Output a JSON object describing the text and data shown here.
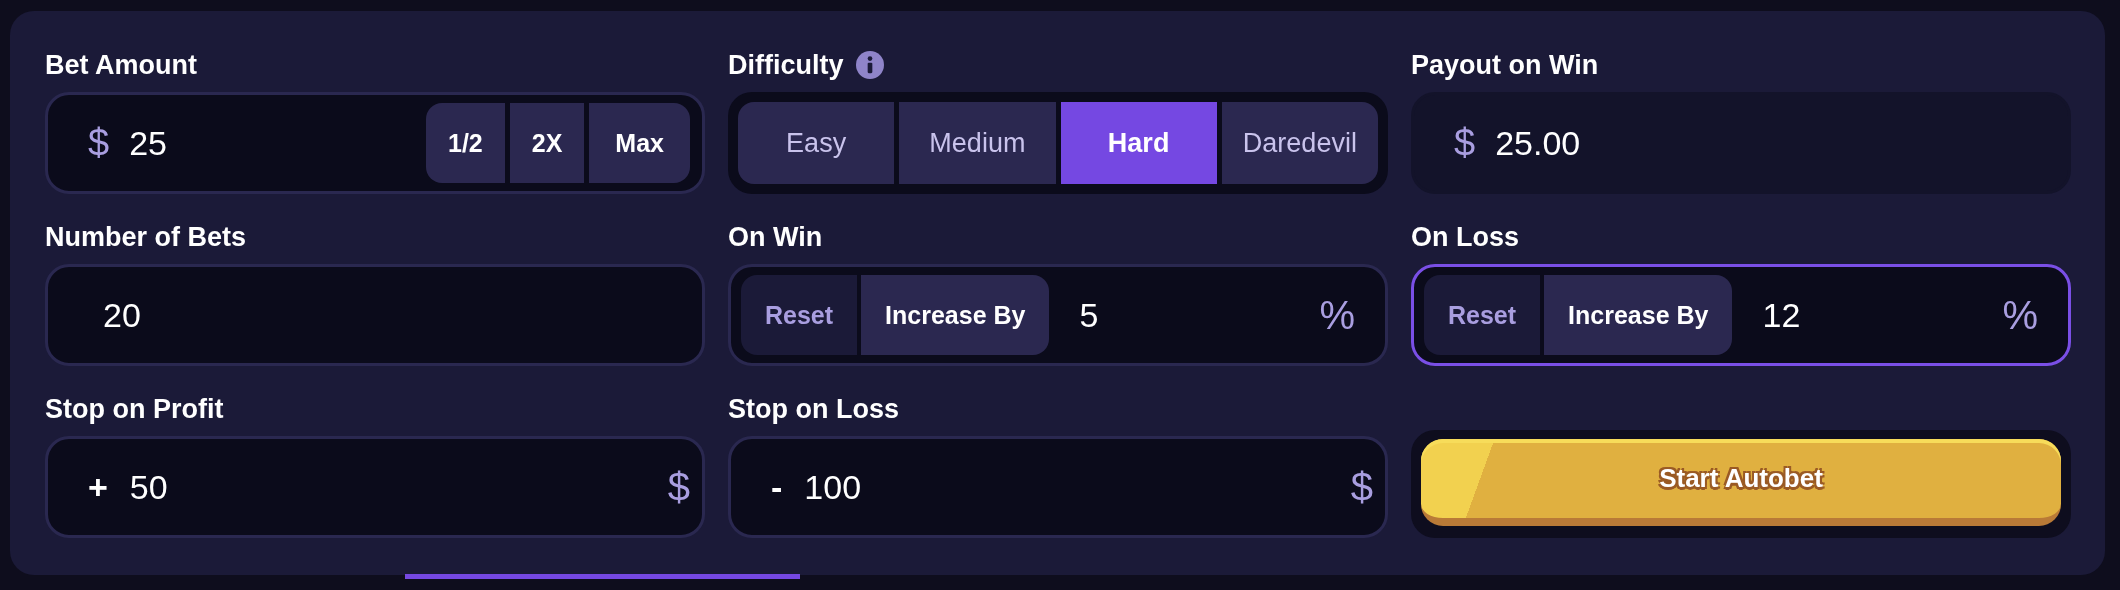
{
  "bet_amount": {
    "label": "Bet Amount",
    "currency": "$",
    "value": "25",
    "buttons": [
      "1/2",
      "2X",
      "Max"
    ]
  },
  "difficulty": {
    "label": "Difficulty",
    "options": [
      {
        "label": "Easy",
        "selected": false
      },
      {
        "label": "Medium",
        "selected": false
      },
      {
        "label": "Hard",
        "selected": true
      },
      {
        "label": "Daredevil",
        "selected": false
      }
    ]
  },
  "payout_on_win": {
    "label": "Payout on Win",
    "currency": "$",
    "value": "25.00"
  },
  "number_of_bets": {
    "label": "Number of Bets",
    "value": "20"
  },
  "on_win": {
    "label": "On Win",
    "focused": false,
    "modes": [
      {
        "label": "Reset",
        "selected": false
      },
      {
        "label": "Increase By",
        "selected": true
      }
    ],
    "value": "5",
    "unit": "%"
  },
  "on_loss": {
    "label": "On Loss",
    "focused": true,
    "modes": [
      {
        "label": "Reset",
        "selected": false
      },
      {
        "label": "Increase By",
        "selected": true
      }
    ],
    "value": "12",
    "unit": "%"
  },
  "stop_on_profit": {
    "label": "Stop on Profit",
    "sign": "+",
    "value": "50",
    "currency": "$"
  },
  "stop_on_loss": {
    "label": "Stop on Loss",
    "sign": "-",
    "value": "100",
    "currency": "$"
  },
  "start_button": {
    "label": "Start Autobet"
  }
}
